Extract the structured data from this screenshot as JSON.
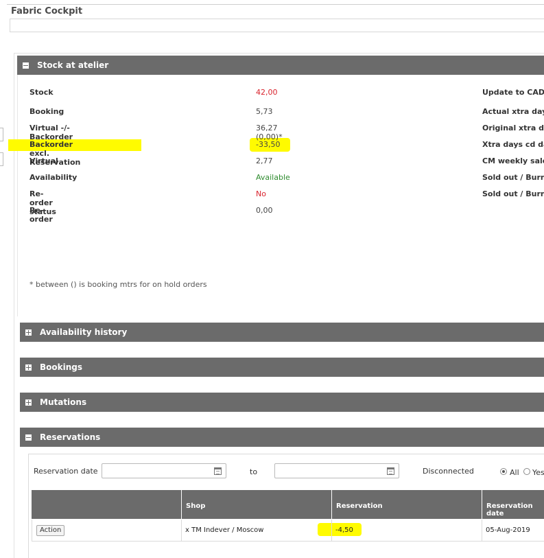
{
  "app": {
    "title": "Fabric Cockpit"
  },
  "stock_panel": {
    "title": "Stock at atelier",
    "rows": [
      {
        "label": "Stock",
        "value": "42,00"
      },
      {
        "label": "Booking",
        "value": "5,73"
      },
      {
        "label": "Virtual -/- Backorder",
        "value": "36,27 (0,00)*"
      },
      {
        "label": "Backorder excl. Reservation",
        "value": "-33,50"
      },
      {
        "label": "Virtual",
        "value": "2,77"
      },
      {
        "label": "Availability",
        "value": "Available"
      },
      {
        "label": "Re-order status",
        "value": "No"
      },
      {
        "label": "Re-order",
        "value": "0,00"
      }
    ],
    "right_labels": [
      "Update to CAD",
      "Actual xtra days",
      "Original xtra day",
      "Xtra days cd dat",
      "CM weekly sales",
      "Sold out / Burnt",
      "Sold out / Burnt"
    ],
    "footnote": "* between () is booking mtrs for on hold orders",
    "colors": {
      "red": "#d9232d",
      "green": "#2e8b2e",
      "highlight": "#fffb00"
    }
  },
  "sections": {
    "availability_history": "Availability history",
    "bookings": "Bookings",
    "mutations": "Mutations",
    "reservations": "Reservations"
  },
  "reservations": {
    "filter": {
      "reservation_date_label": "Reservation date",
      "to_label": "to",
      "disconnected_label": "Disconnected",
      "options": [
        "All",
        "Yes"
      ],
      "selected": "All"
    },
    "table": {
      "headers": [
        "",
        "Shop",
        "Reservation",
        "Reservation date"
      ],
      "rows": [
        {
          "action": "Action",
          "shop": "x TM Indever / Moscow",
          "reservation": "-4,50",
          "date": "05-Aug-2019"
        }
      ]
    }
  }
}
